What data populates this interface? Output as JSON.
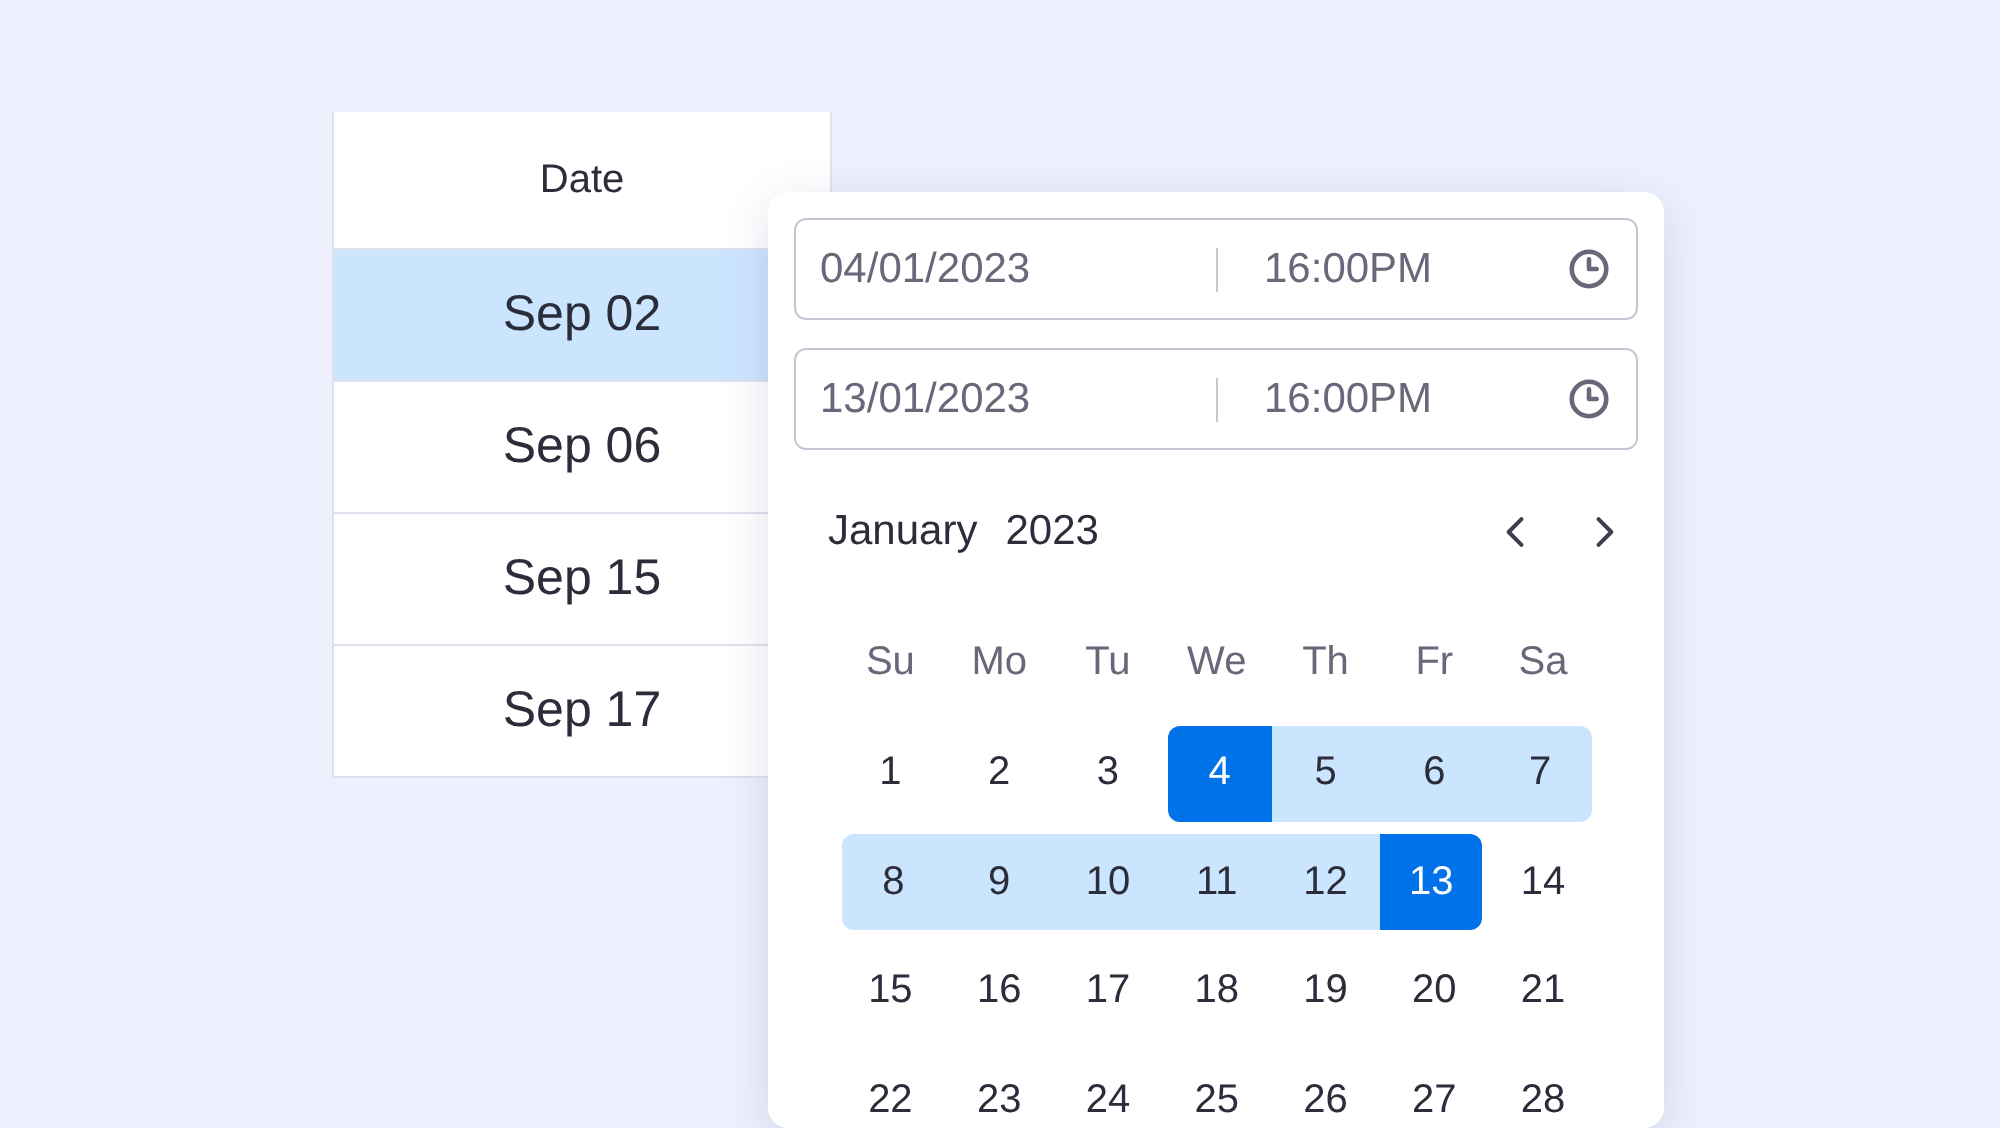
{
  "table": {
    "columns": [
      "Date"
    ],
    "rows": [
      {
        "date": "Sep 02",
        "selected": true
      },
      {
        "date": "Sep 06",
        "selected": false
      },
      {
        "date": "Sep 15",
        "selected": false
      },
      {
        "date": "Sep 17",
        "selected": false
      }
    ]
  },
  "picker": {
    "ranges": [
      {
        "date": "04/01/2023",
        "time": "16:00PM"
      },
      {
        "date": "13/01/2023",
        "time": "16:00PM"
      }
    ],
    "month": "January",
    "year": "2023",
    "weekdays": [
      "Su",
      "Mo",
      "Tu",
      "We",
      "Th",
      "Fr",
      "Sa"
    ],
    "days": [
      {
        "day": "1",
        "selected": false,
        "in_range": false
      },
      {
        "day": "2",
        "selected": false,
        "in_range": false
      },
      {
        "day": "3",
        "selected": false,
        "in_range": false
      },
      {
        "day": "4",
        "selected": true,
        "in_range": true
      },
      {
        "day": "5",
        "selected": false,
        "in_range": true
      },
      {
        "day": "6",
        "selected": false,
        "in_range": true
      },
      {
        "day": "7",
        "selected": false,
        "in_range": true
      },
      {
        "day": "8",
        "selected": false,
        "in_range": true
      },
      {
        "day": "9",
        "selected": false,
        "in_range": true
      },
      {
        "day": "10",
        "selected": false,
        "in_range": true
      },
      {
        "day": "11",
        "selected": false,
        "in_range": true
      },
      {
        "day": "12",
        "selected": false,
        "in_range": true
      },
      {
        "day": "13",
        "selected": true,
        "in_range": true
      },
      {
        "day": "14",
        "selected": false,
        "in_range": false
      },
      {
        "day": "15",
        "selected": false,
        "in_range": false
      },
      {
        "day": "16",
        "selected": false,
        "in_range": false
      },
      {
        "day": "17",
        "selected": false,
        "in_range": false
      },
      {
        "day": "18",
        "selected": false,
        "in_range": false
      },
      {
        "day": "19",
        "selected": false,
        "in_range": false
      },
      {
        "day": "20",
        "selected": false,
        "in_range": false
      },
      {
        "day": "21",
        "selected": false,
        "in_range": false
      },
      {
        "day": "22",
        "selected": false,
        "in_range": false
      },
      {
        "day": "23",
        "selected": false,
        "in_range": false
      },
      {
        "day": "24",
        "selected": false,
        "in_range": false
      },
      {
        "day": "25",
        "selected": false,
        "in_range": false
      },
      {
        "day": "26",
        "selected": false,
        "in_range": false
      },
      {
        "day": "27",
        "selected": false,
        "in_range": false
      },
      {
        "day": "28",
        "selected": false,
        "in_range": false
      }
    ]
  }
}
